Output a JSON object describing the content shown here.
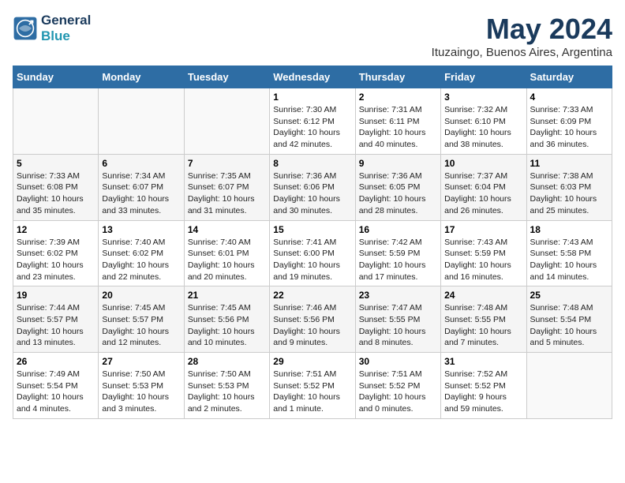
{
  "logo": {
    "line1": "General",
    "line2": "Blue"
  },
  "title": "May 2024",
  "subtitle": "Ituzaingo, Buenos Aires, Argentina",
  "days_of_week": [
    "Sunday",
    "Monday",
    "Tuesday",
    "Wednesday",
    "Thursday",
    "Friday",
    "Saturday"
  ],
  "weeks": [
    {
      "days": [
        {
          "num": "",
          "info": ""
        },
        {
          "num": "",
          "info": ""
        },
        {
          "num": "",
          "info": ""
        },
        {
          "num": "1",
          "info": "Sunrise: 7:30 AM\nSunset: 6:12 PM\nDaylight: 10 hours\nand 42 minutes."
        },
        {
          "num": "2",
          "info": "Sunrise: 7:31 AM\nSunset: 6:11 PM\nDaylight: 10 hours\nand 40 minutes."
        },
        {
          "num": "3",
          "info": "Sunrise: 7:32 AM\nSunset: 6:10 PM\nDaylight: 10 hours\nand 38 minutes."
        },
        {
          "num": "4",
          "info": "Sunrise: 7:33 AM\nSunset: 6:09 PM\nDaylight: 10 hours\nand 36 minutes."
        }
      ]
    },
    {
      "days": [
        {
          "num": "5",
          "info": "Sunrise: 7:33 AM\nSunset: 6:08 PM\nDaylight: 10 hours\nand 35 minutes."
        },
        {
          "num": "6",
          "info": "Sunrise: 7:34 AM\nSunset: 6:07 PM\nDaylight: 10 hours\nand 33 minutes."
        },
        {
          "num": "7",
          "info": "Sunrise: 7:35 AM\nSunset: 6:07 PM\nDaylight: 10 hours\nand 31 minutes."
        },
        {
          "num": "8",
          "info": "Sunrise: 7:36 AM\nSunset: 6:06 PM\nDaylight: 10 hours\nand 30 minutes."
        },
        {
          "num": "9",
          "info": "Sunrise: 7:36 AM\nSunset: 6:05 PM\nDaylight: 10 hours\nand 28 minutes."
        },
        {
          "num": "10",
          "info": "Sunrise: 7:37 AM\nSunset: 6:04 PM\nDaylight: 10 hours\nand 26 minutes."
        },
        {
          "num": "11",
          "info": "Sunrise: 7:38 AM\nSunset: 6:03 PM\nDaylight: 10 hours\nand 25 minutes."
        }
      ]
    },
    {
      "days": [
        {
          "num": "12",
          "info": "Sunrise: 7:39 AM\nSunset: 6:02 PM\nDaylight: 10 hours\nand 23 minutes."
        },
        {
          "num": "13",
          "info": "Sunrise: 7:40 AM\nSunset: 6:02 PM\nDaylight: 10 hours\nand 22 minutes."
        },
        {
          "num": "14",
          "info": "Sunrise: 7:40 AM\nSunset: 6:01 PM\nDaylight: 10 hours\nand 20 minutes."
        },
        {
          "num": "15",
          "info": "Sunrise: 7:41 AM\nSunset: 6:00 PM\nDaylight: 10 hours\nand 19 minutes."
        },
        {
          "num": "16",
          "info": "Sunrise: 7:42 AM\nSunset: 5:59 PM\nDaylight: 10 hours\nand 17 minutes."
        },
        {
          "num": "17",
          "info": "Sunrise: 7:43 AM\nSunset: 5:59 PM\nDaylight: 10 hours\nand 16 minutes."
        },
        {
          "num": "18",
          "info": "Sunrise: 7:43 AM\nSunset: 5:58 PM\nDaylight: 10 hours\nand 14 minutes."
        }
      ]
    },
    {
      "days": [
        {
          "num": "19",
          "info": "Sunrise: 7:44 AM\nSunset: 5:57 PM\nDaylight: 10 hours\nand 13 minutes."
        },
        {
          "num": "20",
          "info": "Sunrise: 7:45 AM\nSunset: 5:57 PM\nDaylight: 10 hours\nand 12 minutes."
        },
        {
          "num": "21",
          "info": "Sunrise: 7:45 AM\nSunset: 5:56 PM\nDaylight: 10 hours\nand 10 minutes."
        },
        {
          "num": "22",
          "info": "Sunrise: 7:46 AM\nSunset: 5:56 PM\nDaylight: 10 hours\nand 9 minutes."
        },
        {
          "num": "23",
          "info": "Sunrise: 7:47 AM\nSunset: 5:55 PM\nDaylight: 10 hours\nand 8 minutes."
        },
        {
          "num": "24",
          "info": "Sunrise: 7:48 AM\nSunset: 5:55 PM\nDaylight: 10 hours\nand 7 minutes."
        },
        {
          "num": "25",
          "info": "Sunrise: 7:48 AM\nSunset: 5:54 PM\nDaylight: 10 hours\nand 5 minutes."
        }
      ]
    },
    {
      "days": [
        {
          "num": "26",
          "info": "Sunrise: 7:49 AM\nSunset: 5:54 PM\nDaylight: 10 hours\nand 4 minutes."
        },
        {
          "num": "27",
          "info": "Sunrise: 7:50 AM\nSunset: 5:53 PM\nDaylight: 10 hours\nand 3 minutes."
        },
        {
          "num": "28",
          "info": "Sunrise: 7:50 AM\nSunset: 5:53 PM\nDaylight: 10 hours\nand 2 minutes."
        },
        {
          "num": "29",
          "info": "Sunrise: 7:51 AM\nSunset: 5:52 PM\nDaylight: 10 hours\nand 1 minute."
        },
        {
          "num": "30",
          "info": "Sunrise: 7:51 AM\nSunset: 5:52 PM\nDaylight: 10 hours\nand 0 minutes."
        },
        {
          "num": "31",
          "info": "Sunrise: 7:52 AM\nSunset: 5:52 PM\nDaylight: 9 hours\nand 59 minutes."
        },
        {
          "num": "",
          "info": ""
        }
      ]
    }
  ]
}
